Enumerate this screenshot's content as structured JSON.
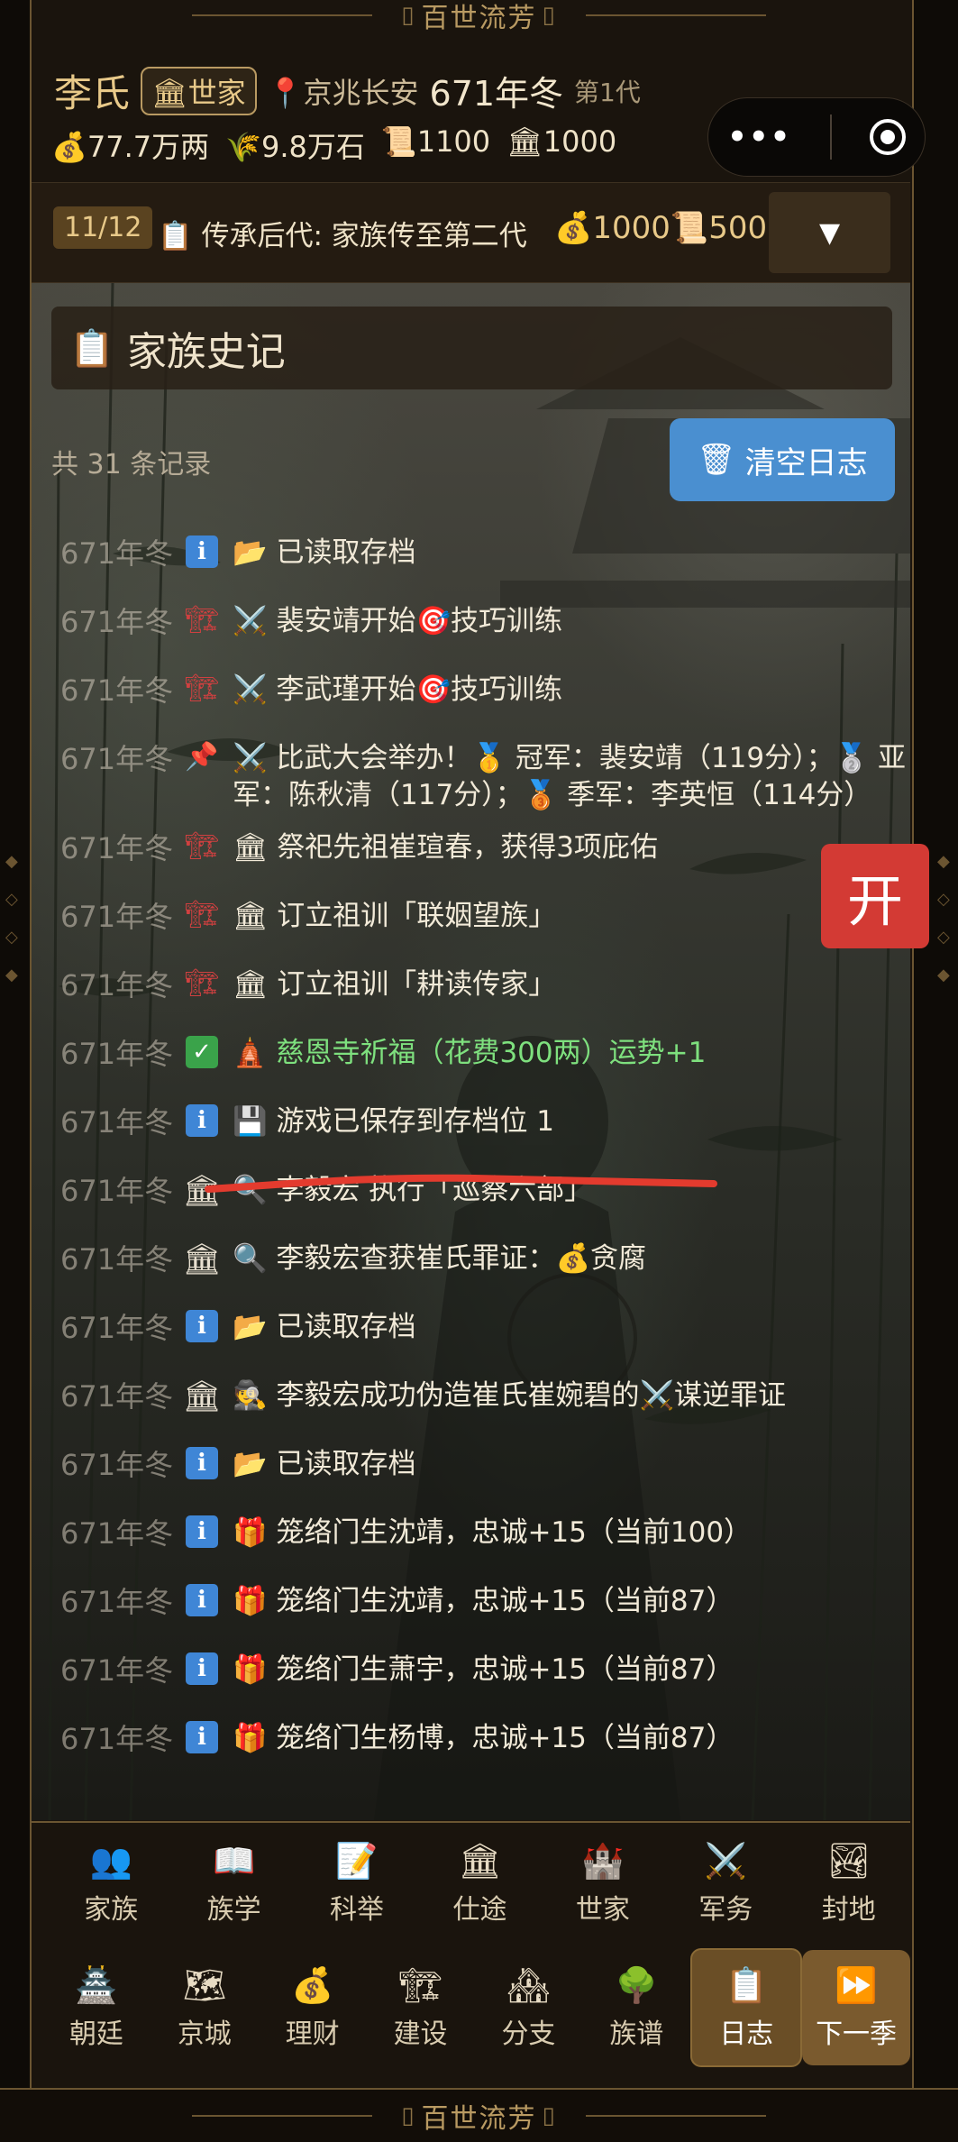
{
  "banner": {
    "text": "百世流芳"
  },
  "header": {
    "family_name": "李氏",
    "rank_icon": "🏛",
    "rank": "世家",
    "location_icon": "📍",
    "location": "京兆长安",
    "year_season": "671年冬",
    "generation": "第1代",
    "resources": [
      {
        "icon": "💰",
        "value": "77.7万两"
      },
      {
        "icon": "🌾",
        "value": "9.8万石"
      },
      {
        "icon": "📜",
        "value": "1100"
      },
      {
        "icon": "🏛",
        "value": "1000"
      }
    ]
  },
  "capsule": {
    "menu_icon": "more-dots-icon",
    "close_icon": "target-icon"
  },
  "task": {
    "progress": "11/12",
    "icon": "📋",
    "text": "传承后代: 家族传至第二代",
    "reward_money": "💰1000",
    "reward_scroll": "📜500",
    "toggle": "▼"
  },
  "section": {
    "icon": "📋",
    "title": "家族史记"
  },
  "count_text": "共 31 条记录",
  "clear_button": {
    "icon": "🗑",
    "label": "清空日志"
  },
  "float_button": "开",
  "entries": [
    {
      "time": "671年冬",
      "tag": "info",
      "msg": "📂 已读取存档"
    },
    {
      "time": "671年冬",
      "tag": "tower",
      "msg": "⚔️ 裴安靖开始🎯技巧训练"
    },
    {
      "time": "671年冬",
      "tag": "tower",
      "msg": "⚔️ 李武瑾开始🎯技巧训练"
    },
    {
      "time": "671年冬",
      "tag": "pin",
      "msg": "⚔️ 比武大会举办！🥇 冠军：裴安靖（119分）；🥈 亚军：陈秋清（117分）；🥉 季军：李英恒（114分）"
    },
    {
      "time": "671年冬",
      "tag": "tower",
      "msg": "🏛 祭祀先祖崔瑄春，获得3项庇佑"
    },
    {
      "time": "671年冬",
      "tag": "tower",
      "msg": "🏛 订立祖训「联姻望族」"
    },
    {
      "time": "671年冬",
      "tag": "tower",
      "msg": "🏛 订立祖训「耕读传家」"
    },
    {
      "time": "671年冬",
      "tag": "check",
      "msg": "🛕 慈恩寺祈福（花费300两）运势+1",
      "green": true
    },
    {
      "time": "671年冬",
      "tag": "info",
      "msg": "💾 游戏已保存到存档位 1"
    },
    {
      "time": "671年冬",
      "tag": "building",
      "msg": "🔍 李毅宏 执行「巡察六部」"
    },
    {
      "time": "671年冬",
      "tag": "building",
      "msg": "🔍 李毅宏查获崔氏罪证：💰贪腐"
    },
    {
      "time": "671年冬",
      "tag": "info",
      "msg": "📂 已读取存档"
    },
    {
      "time": "671年冬",
      "tag": "building",
      "msg": "🕵 李毅宏成功伪造崔氏崔婉碧的⚔️谋逆罪证"
    },
    {
      "time": "671年冬",
      "tag": "info",
      "msg": "📂 已读取存档"
    },
    {
      "time": "671年冬",
      "tag": "info",
      "msg": "🎁 笼络门生沈靖，忠诚+15（当前100）"
    },
    {
      "time": "671年冬",
      "tag": "info",
      "msg": "🎁 笼络门生沈靖，忠诚+15（当前87）"
    },
    {
      "time": "671年冬",
      "tag": "info",
      "msg": "🎁 笼络门生萧宇，忠诚+15（当前87）"
    },
    {
      "time": "671年冬",
      "tag": "info",
      "msg": "🎁 笼络门生杨博，忠诚+15（当前87）"
    }
  ],
  "nav_row1": [
    {
      "icon": "👥",
      "label": "家族"
    },
    {
      "icon": "📖",
      "label": "族学"
    },
    {
      "icon": "📝",
      "label": "科举"
    },
    {
      "icon": "🏛",
      "label": "仕途"
    },
    {
      "icon": "🏰",
      "label": "世家"
    },
    {
      "icon": "⚔️",
      "label": "军务"
    },
    {
      "icon": "🏞",
      "label": "封地"
    }
  ],
  "nav_row2": [
    {
      "icon": "🏯",
      "label": "朝廷"
    },
    {
      "icon": "🗺",
      "label": "京城"
    },
    {
      "icon": "💰",
      "label": "理财"
    },
    {
      "icon": "🏗",
      "label": "建设"
    },
    {
      "icon": "🏘",
      "label": "分支"
    },
    {
      "icon": "🌳",
      "label": "族谱"
    },
    {
      "icon": "📋",
      "label": "日志",
      "active": true
    },
    {
      "icon": "⏩",
      "label": "下一季",
      "next": true
    }
  ]
}
